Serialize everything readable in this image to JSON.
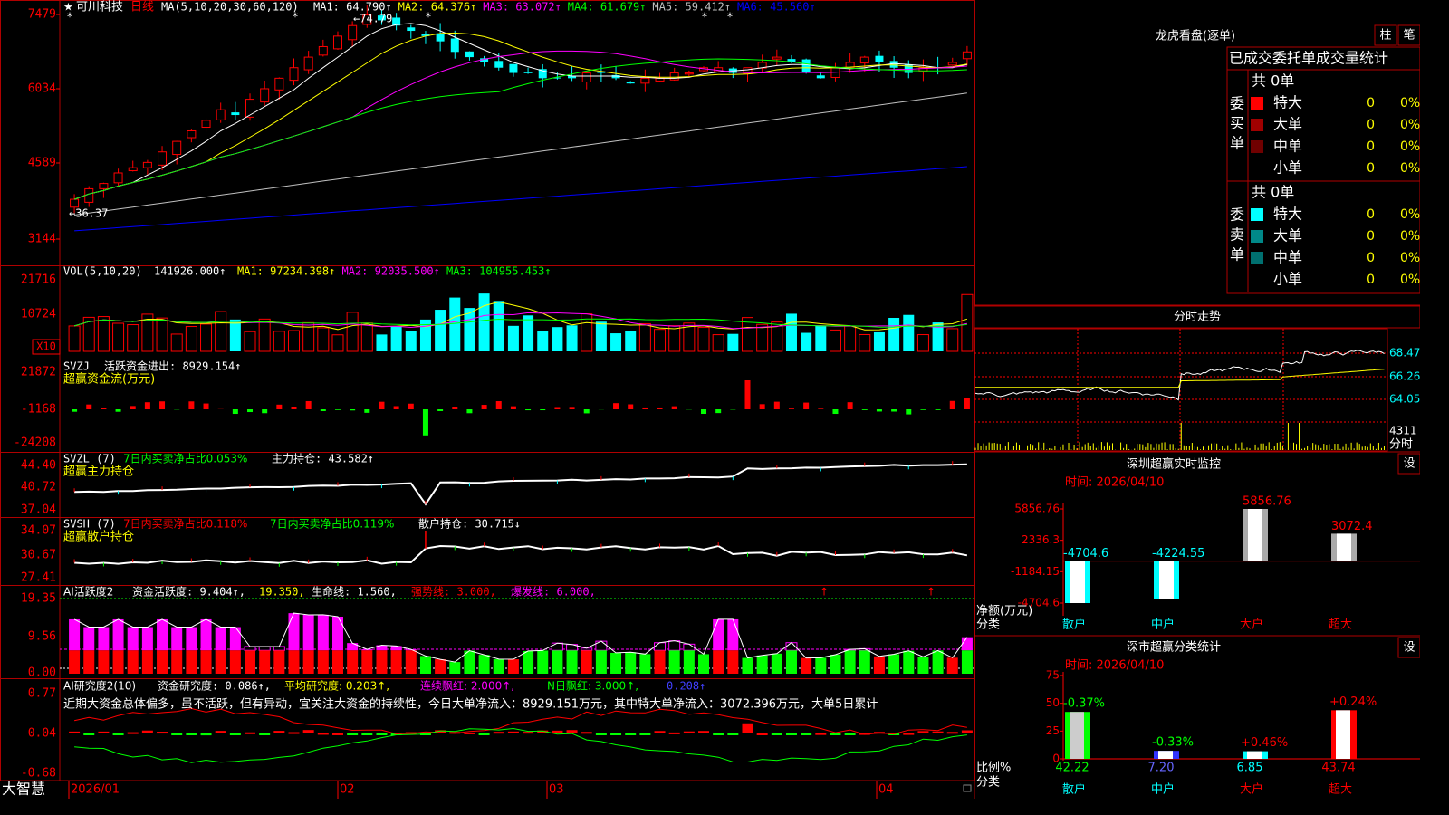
{
  "stock": {
    "name": "可川科技",
    "period": "日线"
  },
  "ma_params": "MA(5,10,20,30,60,120)",
  "ma_lines": [
    {
      "label": "MA1:",
      "value": "64.790",
      "arrow": "↑",
      "color": "#ffffff"
    },
    {
      "label": "MA2:",
      "value": "64.376",
      "arrow": "↑",
      "color": "#ffff00"
    },
    {
      "label": "MA3:",
      "value": "63.072",
      "arrow": "↑",
      "color": "#ff00ff"
    },
    {
      "label": "MA4:",
      "value": "61.679",
      "arrow": "↑",
      "color": "#00ff00"
    },
    {
      "label": "MA5:",
      "value": "59.412",
      "arrow": "↑",
      "color": "#c0c0c0"
    },
    {
      "label": "MA6:",
      "value": "45.560",
      "arrow": "↑",
      "color": "#0000ff"
    }
  ],
  "price_axis": [
    "7479",
    "6034",
    "4589",
    "3144"
  ],
  "price_high": "74.79",
  "price_low": "36.37",
  "vol": {
    "params": "VOL(5,10,20)",
    "value": "141926.000",
    "arrow": "↑",
    "mas": [
      {
        "label": "MA1:",
        "value": "97234.398",
        "arrow": "↑",
        "color": "#ffff00"
      },
      {
        "label": "MA2:",
        "value": "92035.500",
        "arrow": "↑",
        "color": "#ff00ff"
      },
      {
        "label": "MA3:",
        "value": "104955.453",
        "arrow": "↑",
        "color": "#00ff00"
      }
    ],
    "axis": [
      "21716",
      "10724"
    ],
    "unit": "X10"
  },
  "svzj": {
    "name": "SVZJ",
    "label": "活跃资金进出:",
    "value": "8929.154",
    "arrow": "↑",
    "sub": "超赢资金流(万元)",
    "axis": [
      "21872",
      "-1168",
      "-24208"
    ]
  },
  "svzl": {
    "name": "SVZL (7)",
    "p1": "7日内买卖净占比0.053%",
    "p2": "主力持仓:",
    "value": "43.582",
    "arrow": "↑",
    "sub": "超赢主力持仓",
    "axis": [
      "44.40",
      "40.72",
      "37.04"
    ]
  },
  "svsh": {
    "name": "SVSH (7)",
    "p1": "7日内买卖净占比0.118%",
    "p2": "7日内买卖净占比0.119%",
    "p3": "散户持仓:",
    "value": "30.715",
    "arrow": "↓",
    "sub": "超赢散户持仓",
    "axis": [
      "34.07",
      "30.67",
      "27.41"
    ]
  },
  "ai2": {
    "name": "AI活跃度2",
    "l1": "资金活跃度:",
    "v1": "9.404",
    "a1": "↑",
    "v2": "19.350",
    "l3": "生命线:",
    "v3": "1.560",
    "l4": "强势线:",
    "v4": "3.000",
    "l5": "爆发线:",
    "v5": "6.000",
    "axis": [
      "19.35",
      "9.56",
      "0.00"
    ]
  },
  "air": {
    "name": "AI研究度2(10)",
    "l1": "资金研究度:",
    "v1": "0.086",
    "a1": "↑",
    "l2": "平均研究度:",
    "v2": "0.203",
    "a2": "↑",
    "l3": "连续飘红:",
    "v3": "2.000",
    "a3": "↑",
    "l4": "N日飘红:",
    "v4": "3.000",
    "a4": "↑",
    "v5": "0.208",
    "a5": "↑",
    "note": "近期大资金总体偏多，虽不活跃，但有异动，宜关注大资金的持续性，今日大单净流入：8929.151万元，其中特大单净流入：3072.396万元，大单5日累计",
    "axis": [
      "0.77",
      "0.04",
      "-0.68"
    ]
  },
  "dates": [
    "2026/01",
    "02",
    "03",
    "04"
  ],
  "brand": "大智慧",
  "right": {
    "lhb_title": "龙虎看盘(逐单)",
    "btn_bar": "柱",
    "btn_pen": "笔",
    "stat_title": "已成交委托单成交量统计",
    "buy": {
      "side": [
        "委",
        "买",
        "单"
      ],
      "total": "共 0单",
      "rows": [
        {
          "name": "特大",
          "v": "0",
          "p": "0%",
          "c": "#ff0000"
        },
        {
          "name": "大单",
          "v": "0",
          "p": "0%",
          "c": "#a00000"
        },
        {
          "name": "中单",
          "v": "0",
          "p": "0%",
          "c": "#700000"
        },
        {
          "name": "小单",
          "v": "0",
          "p": "0%",
          "c": ""
        }
      ]
    },
    "sell": {
      "side": [
        "委",
        "卖",
        "单"
      ],
      "total": "共 0单",
      "rows": [
        {
          "name": "特大",
          "v": "0",
          "p": "0%",
          "c": "#00ffff"
        },
        {
          "name": "大单",
          "v": "0",
          "p": "0%",
          "c": "#008888"
        },
        {
          "name": "中单",
          "v": "0",
          "p": "0%",
          "c": "#007070"
        },
        {
          "name": "小单",
          "v": "0",
          "p": "0%",
          "c": ""
        }
      ]
    },
    "intraday": {
      "title": "分时走势",
      "axis": [
        "68.47",
        "66.26",
        "64.05"
      ],
      "vol": "4311",
      "vol_label": "分时"
    },
    "sz": {
      "title": "深圳超赢实时监控",
      "btn": "设",
      "time": "时间: 2026/04/10",
      "axis": [
        "5856.76",
        "2336.3",
        "-1184.15",
        "-4704.6"
      ],
      "ylabel": "净额(万元)",
      "xlabel": "分类",
      "bars": [
        {
          "name": "散户",
          "value": -4704.6,
          "label": "-4704.6"
        },
        {
          "name": "中户",
          "value": -4224.55,
          "label": "-4224.55"
        },
        {
          "name": "大户",
          "value": 5856.76,
          "label": "5856.76"
        },
        {
          "name": "超大",
          "value": 3072.4,
          "label": "3072.4"
        }
      ]
    },
    "cls": {
      "title": "深市超赢分类统计",
      "btn": "设",
      "time": "时间: 2026/04/10",
      "axis": [
        "75",
        "50",
        "25",
        "0"
      ],
      "ylabel": "比例%",
      "xlabel": "分类",
      "bars": [
        {
          "name": "散户",
          "value": 42.22,
          "chg": "-0.37%"
        },
        {
          "name": "中户",
          "value": 7.2,
          "chg": "-0.33%"
        },
        {
          "name": "大户",
          "value": 6.85,
          "chg": "+0.46%"
        },
        {
          "name": "超大",
          "value": 43.74,
          "chg": "+0.24%"
        }
      ]
    }
  }
}
